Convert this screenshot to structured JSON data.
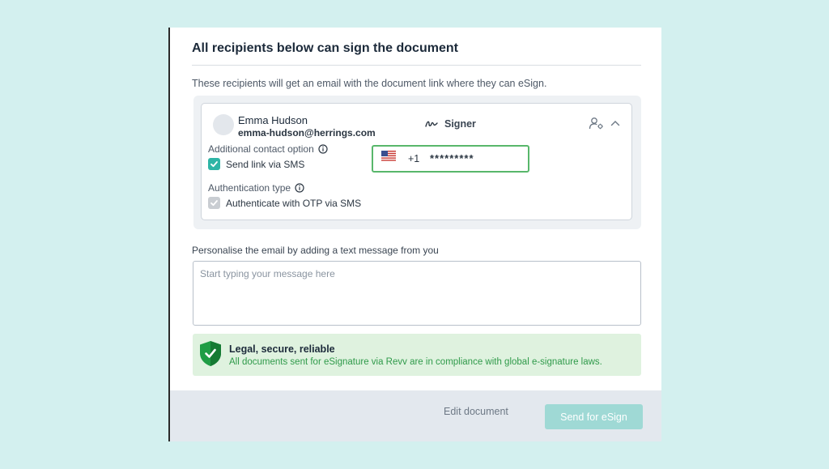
{
  "dialog": {
    "title": "All recipients below can sign the document",
    "subtitle": "These recipients will get an email with the document link where they can eSign."
  },
  "recipient": {
    "name": "Emma Hudson",
    "email": "emma-hudson@herrings.com",
    "role": "Signer",
    "contact_option_label": "Additional contact option",
    "send_sms_label": "Send link via SMS",
    "send_sms_checked": true,
    "phone_country": "US",
    "phone_code": "+1",
    "phone_value": "*********",
    "auth_type_label": "Authentication type",
    "auth_otp_label": "Authenticate with OTP via SMS",
    "auth_otp_checked": true,
    "auth_otp_disabled": true
  },
  "message": {
    "label": "Personalise the email by adding a text message from you",
    "placeholder": "Start typing your message here",
    "value": ""
  },
  "secure": {
    "title": "Legal, secure, reliable",
    "text": "All documents sent for eSignature via Revv are in compliance with global e-signature laws."
  },
  "footer": {
    "edit_label": "Edit document",
    "send_label": "Send for eSign"
  },
  "colors": {
    "accent": "#2fb5a6",
    "send_button": "#9fd9d5",
    "secure_green": "#2f9a4a",
    "phone_border": "#58b76b"
  },
  "icons": {
    "role": "signature-icon",
    "settings": "user-settings-icon",
    "collapse": "chevron-up-icon",
    "info": "info-icon",
    "shield": "shield-check-icon",
    "flag": "us-flag-icon"
  }
}
